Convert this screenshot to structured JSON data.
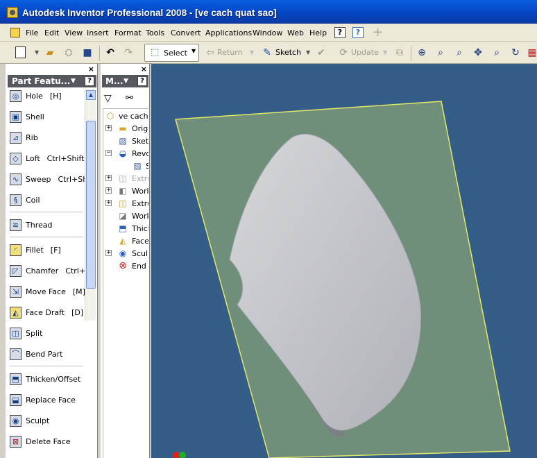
{
  "window": {
    "title": "Autodesk Inventor Professional 2008 - [ve cach quat sao]"
  },
  "menu": [
    "File",
    "Edit",
    "View",
    "Insert",
    "Format",
    "Tools",
    "Convert",
    "Applications",
    "Window",
    "Web",
    "Help"
  ],
  "toolbar": {
    "select_label": "Select",
    "return_label": "Return",
    "sketch_label": "Sketch",
    "update_label": "Update"
  },
  "left_panel": {
    "header": "Part Featu...",
    "items": [
      {
        "label": "Hole",
        "key": "[H]"
      },
      {
        "label": "Shell",
        "key": ""
      },
      {
        "label": "Rib",
        "key": ""
      },
      {
        "label": "Loft",
        "key": "Ctrl+Shift+"
      },
      {
        "label": "Sweep",
        "key": "Ctrl+Shif"
      },
      {
        "label": "Coil",
        "key": ""
      },
      {
        "label": "Thread",
        "key": ""
      },
      {
        "label": "Fillet",
        "key": "[F]"
      },
      {
        "label": "Chamfer",
        "key": "Ctrl+Sh"
      },
      {
        "label": "Move Face",
        "key": "[M]"
      },
      {
        "label": "Face Draft",
        "key": "[D]"
      },
      {
        "label": "Split",
        "key": ""
      },
      {
        "label": "Bend Part",
        "key": ""
      },
      {
        "label": "Thicken/Offset",
        "key": ""
      },
      {
        "label": "Replace Face",
        "key": ""
      },
      {
        "label": "Sculpt",
        "key": ""
      },
      {
        "label": "Delete Face",
        "key": ""
      }
    ]
  },
  "model_panel": {
    "header": "M...",
    "tree": [
      {
        "label": "ve cach q"
      },
      {
        "label": "Origin"
      },
      {
        "label": "Sketch"
      },
      {
        "label": "Revol"
      },
      {
        "label": "S"
      },
      {
        "label": "Extru"
      },
      {
        "label": "Work"
      },
      {
        "label": "Extru"
      },
      {
        "label": "Work"
      },
      {
        "label": "Thick"
      },
      {
        "label": "Face"
      },
      {
        "label": "Sculp"
      },
      {
        "label": "End o"
      }
    ]
  },
  "colors": {
    "titlebar": "#0a5fe0",
    "viewport_bg": "#345d87",
    "plane": "#6f8f7b",
    "plane_edge": "#e4e86a",
    "part_surface": "#c3c4c9"
  },
  "icons": {
    "toolbar": [
      "new-icon",
      "open-icon",
      "project-icon",
      "save-icon",
      "undo-icon",
      "redo-icon",
      "select-icon",
      "return-icon",
      "sketch-icon",
      "update-icon",
      "zoom-all-icon",
      "zoom-window-icon",
      "zoom-icon",
      "pan-icon",
      "zoom-selected-icon",
      "rotate-icon",
      "look-at-icon"
    ],
    "features": [
      "hole-icon",
      "shell-icon",
      "rib-icon",
      "loft-icon",
      "sweep-icon",
      "coil-icon",
      "thread-icon",
      "fillet-icon",
      "chamfer-icon",
      "move-face-icon",
      "face-draft-icon",
      "split-icon",
      "bend-part-icon",
      "thicken-icon",
      "replace-face-icon",
      "sculpt-icon",
      "delete-face-icon"
    ]
  }
}
